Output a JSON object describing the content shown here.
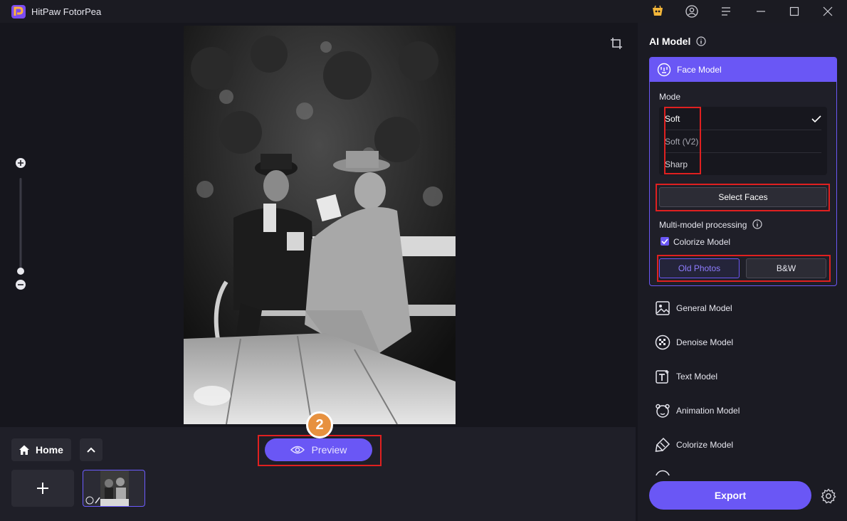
{
  "app": {
    "title": "HitPaw FotorPea",
    "accent_color": "#6a57f5"
  },
  "titlebar": {
    "icons": [
      "store-icon",
      "account-icon",
      "menu-icon",
      "minimize-icon",
      "maximize-icon",
      "close-icon"
    ]
  },
  "canvas": {
    "tool_icons": [
      "crop-icon",
      "zoom-in-icon",
      "zoom-out-icon"
    ]
  },
  "bottom": {
    "home_label": "Home",
    "preview_label": "Preview",
    "step_badge": "2"
  },
  "panel": {
    "title": "AI Model",
    "face_model": {
      "label": "Face Model",
      "mode_label": "Mode",
      "modes": [
        {
          "label": "Soft",
          "selected": true
        },
        {
          "label": "Soft (V2)",
          "selected": false
        },
        {
          "label": "Sharp",
          "selected": false
        }
      ],
      "select_faces_label": "Select Faces",
      "multi_model_label": "Multi-model processing",
      "colorize_label": "Colorize Model",
      "colorize_checked": true,
      "options": [
        {
          "label": "Old Photos",
          "selected": true
        },
        {
          "label": "B&W",
          "selected": false
        }
      ]
    },
    "models": [
      {
        "label": "General Model",
        "icon": "image-icon"
      },
      {
        "label": "Denoise Model",
        "icon": "denoise-icon"
      },
      {
        "label": "Text Model",
        "icon": "text-icon"
      },
      {
        "label": "Animation Model",
        "icon": "animation-icon"
      },
      {
        "label": "Colorize Model",
        "icon": "colorize-icon"
      }
    ],
    "export_label": "Export"
  }
}
